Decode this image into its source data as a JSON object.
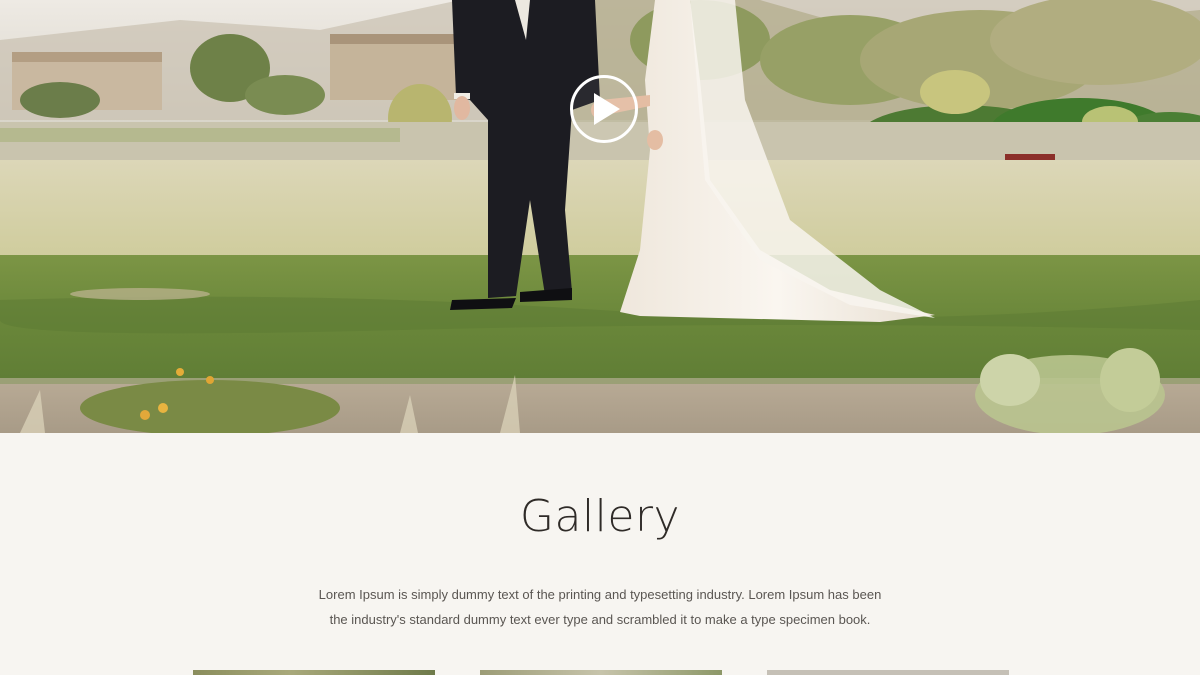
{
  "hero": {
    "play_icon": "play-icon",
    "colors": {
      "sky": "#e9e4dc",
      "lawn": "#6f8b3e",
      "far_lawn": "#d9d4b2",
      "suit": "#1b1b20",
      "dress": "#f3eee6"
    }
  },
  "gallery": {
    "title": "Gallery",
    "description_line_1": "Lorem Ipsum is simply dummy text of the printing and typesetting industry. Lorem Ipsum has been",
    "description_line_2": "the industry's standard dummy text ever type and scrambled it to make a type specimen book."
  },
  "colors": {
    "page_background": "#f7f5f1",
    "title_text": "#2f2b28",
    "body_text": "#5a5652"
  }
}
